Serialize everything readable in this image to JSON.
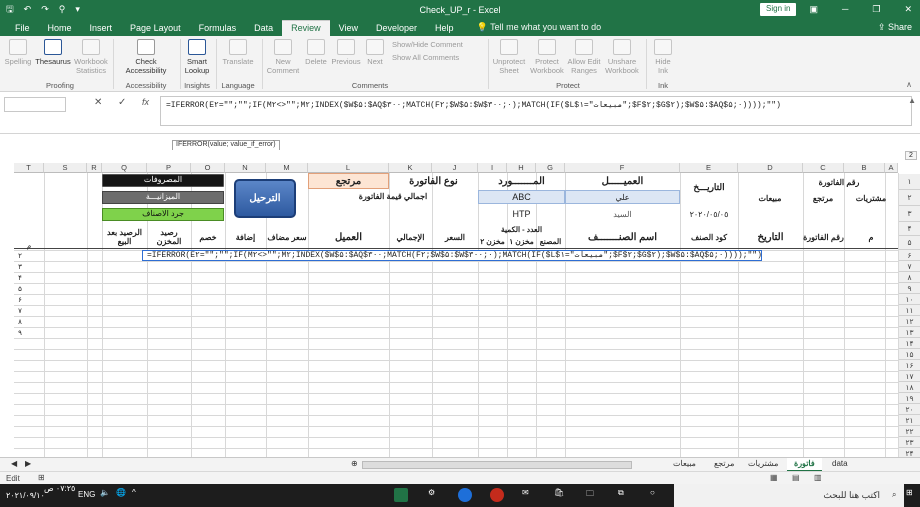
{
  "window": {
    "title": "Check_UP_r  -  Excel",
    "sign_in": "Sign in"
  },
  "menu": {
    "tabs": [
      "File",
      "Home",
      "Insert",
      "Page Layout",
      "Formulas",
      "Data",
      "Review",
      "View",
      "Developer",
      "Help"
    ],
    "tell": "Tell me what you want to do",
    "share": "Share"
  },
  "ribbon": {
    "spelling": "Spelling",
    "thesaurus": "Thesaurus",
    "workbook_statistics": "Workbook Statistics",
    "check_accessibility": "Check Accessibility",
    "smart_lookup": "Smart Lookup",
    "translate": "Translate",
    "new_comment": "New Comment",
    "delete": "Delete",
    "previous": "Previous",
    "next": "Next",
    "show_hide_comment": "Show/Hide Comment",
    "show_all_comments": "Show All Comments",
    "unprotect_sheet": "Unprotect Sheet",
    "protect_workbook": "Protect Workbook",
    "allow_edit_ranges": "Allow Edit Ranges",
    "unshare_workbook": "Unshare Workbook",
    "hide_ink": "Hide Ink",
    "groups": {
      "proofing": "Proofing",
      "accessibility": "Accessibility",
      "insights": "Insights",
      "language": "Language",
      "comments": "Comments",
      "protect": "Protect",
      "ink": "Ink"
    }
  },
  "formula": {
    "cancel": "✕",
    "enter": "✓",
    "fx": "fx",
    "text": "=IFERROR(E۲=\"\";\"\";IF(M۲<>\"\";M۲;INDEX($W$۵:$AQ$۳۰۰;MATCH(F۲;$W$۵:$W$۳۰۰;۰);MATCH(IF($L$۱=\"مبيعات\";$F$۲;$G$۲);$W$۵:$AQ$۵;۰))));\"\")",
    "tooltip": "IFERROR(value; value_if_error)"
  },
  "columns": [
    "T",
    "S",
    "R",
    "Q",
    "P",
    "O",
    "N",
    "M",
    "L",
    "K",
    "J",
    "I",
    "H",
    "G",
    "F",
    "E",
    "D",
    "C",
    "B",
    "A"
  ],
  "rows": [
    "۱",
    "۲",
    "۳",
    "۴",
    "۵",
    "۶",
    "۷",
    "۸",
    "۹",
    "۱۰",
    "۱۱",
    "۱۲",
    "۱۳",
    "۱۴",
    "۱۵",
    "۱۶",
    "۱۷",
    "۱۸",
    "۱۹",
    "۲۰",
    "۲۱",
    "۲۲",
    "۲۳",
    "۲۴"
  ],
  "outline": [
    "1",
    "2"
  ],
  "sheet": {
    "invoice_no": "رقم الفاتورة",
    "purchases": "مشتريات",
    "returned": "مرتجع",
    "sales": "مبيعات",
    "date_hdr": "التاريـــخ",
    "customer_hdr": "العميـــــل",
    "supplier_hdr": "المـــــــورد",
    "invoice_type": "نوع الفاتورة",
    "return_hdr": "مرتجع",
    "abc": "ABC",
    "ali": "علي",
    "total_value": "اجمالي قيمة الفاتورة",
    "htp": "HTP",
    "sayed": "السيد",
    "date_val": "٢٠٢٠/٠٥/٠٥",
    "h_m": "م",
    "h_invno": "رقم الفاتورة",
    "h_date": "التاريخ",
    "h_code": "كود الصنف",
    "h_item": "اسم الصنـــــــف",
    "h_qty": "العدد - الكمية",
    "h_factory": "المصنع",
    "h_store1": "مخزن ۱",
    "h_store2": "مخزن ۲",
    "h_price": "السعر",
    "h_total": "الإجمالي",
    "h_customer": "العميل",
    "h_added": "سعر مضاف",
    "h_add": "إضافة",
    "h_disc": "خصم",
    "h_balstore": "رصيد المخزن",
    "h_balafter": "الرصيد بعد البيع",
    "btn_expenses": "المصروفات",
    "btn_budget": "الميزانيـــة",
    "btn_inventory": "جرد الاصناف",
    "btn_post": "الترحيل",
    "row_nums": [
      "۲",
      "۳",
      "۴",
      "۵",
      "۶",
      "۷",
      "۸",
      "۹"
    ]
  },
  "tabs": [
    "data",
    "فاتورة",
    "مشتريات",
    "مرتجع",
    "مبيعات"
  ],
  "status": {
    "mode": "Edit"
  },
  "taskbar": {
    "search": "اكتب هنا للبحث",
    "time": "٠٧:٢٥ ص",
    "date": "٢٠٢١/٠٩/١٠",
    "lang": "ENG"
  }
}
